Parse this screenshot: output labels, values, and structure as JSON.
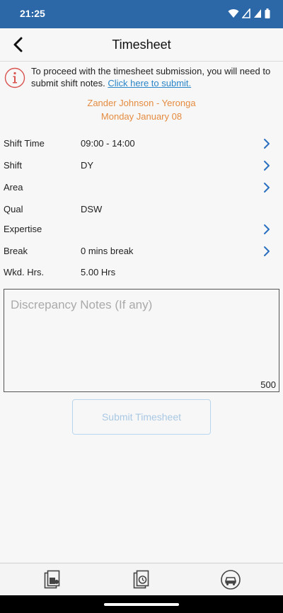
{
  "status_bar": {
    "time": "21:25",
    "icons": [
      "wifi-icon",
      "signal-icon",
      "signal-icon-2",
      "battery-icon"
    ]
  },
  "header": {
    "title": "Timesheet",
    "back_icon": "chevron-left-icon"
  },
  "notice": {
    "icon": "info-icon",
    "text": "To proceed with the timesheet submission, you will need to submit shift notes. ",
    "link_text": "Click here to submit."
  },
  "employee": {
    "name": "Zander Johnson - Yeronga",
    "date": "Monday January 08"
  },
  "details": [
    {
      "label": "Shift Time",
      "value": "09:00 - 14:00",
      "has_chevron": true
    },
    {
      "label": "Shift",
      "value": "DY",
      "has_chevron": true
    },
    {
      "label": "Area",
      "value": "",
      "has_chevron": true
    },
    {
      "label": "Qual",
      "value": "DSW",
      "has_chevron": false
    },
    {
      "label": "Expertise",
      "value": "",
      "has_chevron": true
    },
    {
      "label": "Break",
      "value": "0 mins break",
      "has_chevron": true
    },
    {
      "label": "Wkd. Hrs.",
      "value": "5.00 Hrs",
      "has_chevron": false
    }
  ],
  "notes": {
    "placeholder": "Discrepancy Notes (If any)",
    "counter": "500"
  },
  "submit": {
    "label": "Submit Timesheet"
  },
  "bottom_nav": {
    "items": [
      "documents-icon",
      "timesheet-clock-icon",
      "car-icon"
    ]
  },
  "colors": {
    "status_bar": "#2c68a8",
    "accent_orange": "#e58b3f",
    "link_blue": "#2a86c9",
    "chevron_blue": "#2a6fc0",
    "info_red": "#d9534f"
  }
}
